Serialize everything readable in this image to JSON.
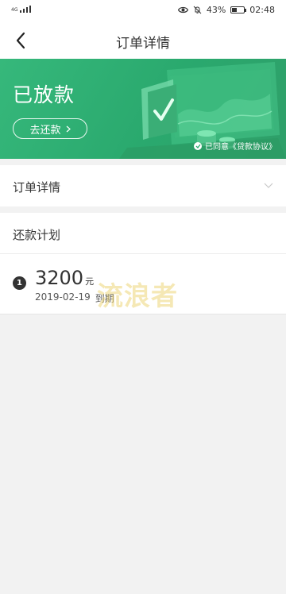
{
  "status_bar": {
    "network": "4G",
    "battery_percent": "43%",
    "battery_level": 0.43,
    "time": "02:48",
    "icons": [
      "eye-icon",
      "mute-icon",
      "battery-icon"
    ]
  },
  "nav": {
    "title": "订单详情",
    "back_icon": "back-arrow-icon"
  },
  "hero": {
    "status": "已放款",
    "repay_button": "去还款",
    "agreement_text": "已同意《贷款协议》",
    "colors": {
      "accent": "#2aa96e"
    }
  },
  "order_detail": {
    "label": "订单详情",
    "icon": "chevron-down-icon"
  },
  "repayment_plan": {
    "title": "还款计划",
    "items": [
      {
        "index": "1",
        "amount": "3200",
        "unit": "元",
        "date": "2019-02-19",
        "due_label": "到期"
      }
    ]
  },
  "watermark": {
    "text": "流浪者"
  }
}
